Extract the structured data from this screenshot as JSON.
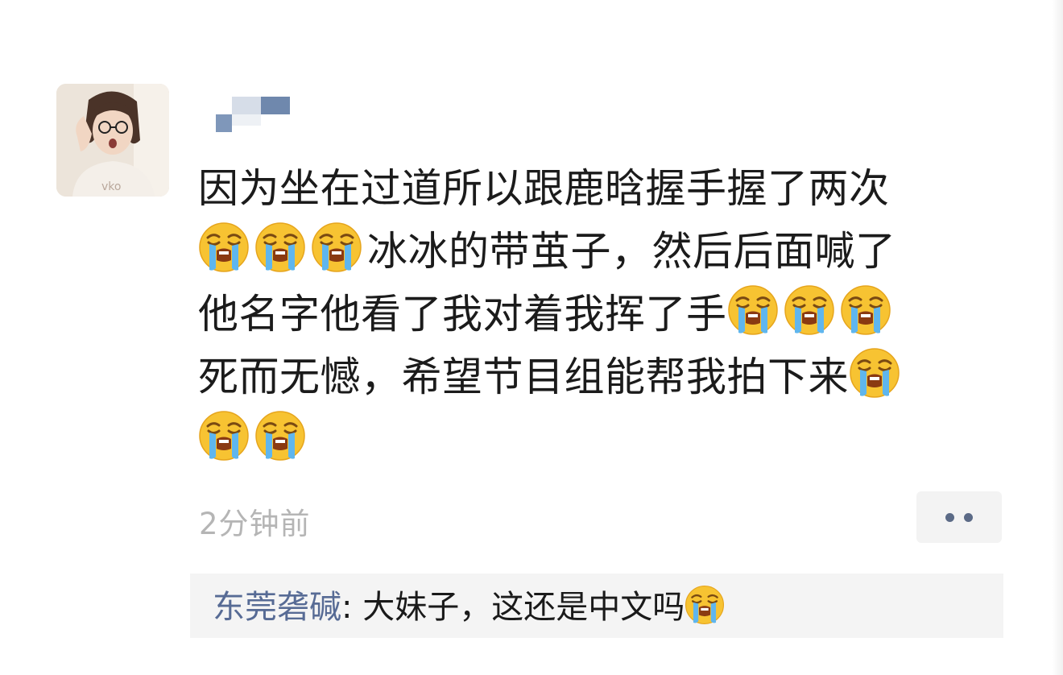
{
  "post": {
    "lines": [
      "因为坐在过道所以跟鹿晗握手握了两次",
      "冰冰的带茧子，然后后面喊了",
      "他名字他看了我对着我挥了手",
      "死而无憾，希望节目组能帮我拍下来"
    ],
    "timestamp": "2分钟前"
  },
  "comment": {
    "author": "东莞砻碱",
    "separator": ": ",
    "text": "大妹子，这还是中文吗"
  },
  "icons": {
    "emoji": "loudly-crying-emoji",
    "more": "more-dots-icon"
  },
  "colors": {
    "link_blue": "#576b95",
    "timestamp_gray": "#b5b5b5",
    "comment_bg": "#f4f4f4"
  }
}
